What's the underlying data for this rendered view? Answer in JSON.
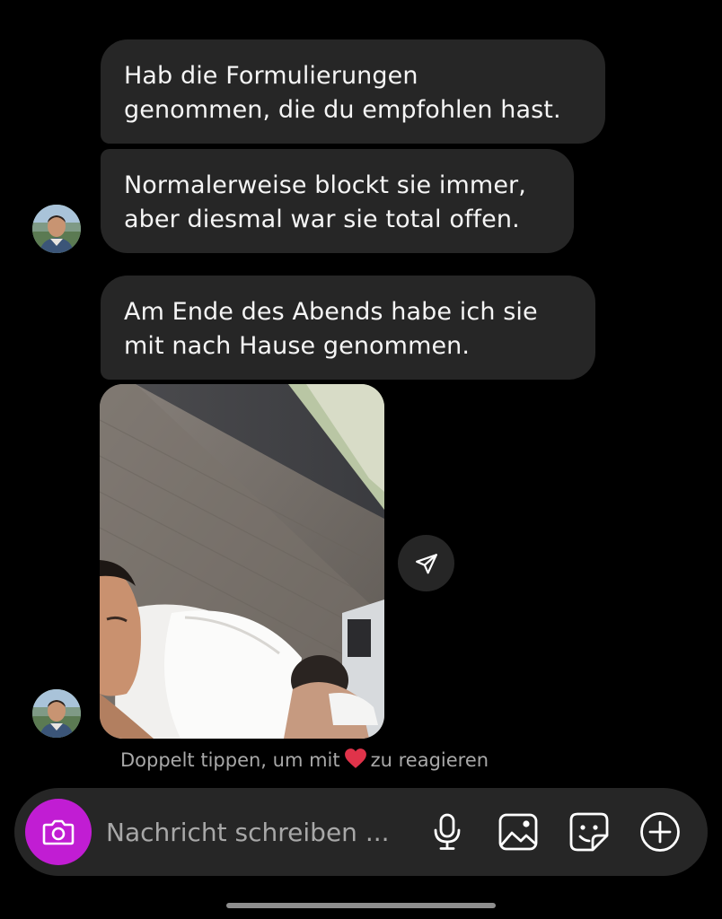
{
  "messages": [
    {
      "lines": [
        "Hab die Formulierungen",
        "genommen, die du empfohlen hast."
      ]
    },
    {
      "lines": [
        "Normalerweise blockt sie immer,",
        "aber diesmal war sie total offen."
      ]
    },
    {
      "lines": [
        "Am Ende des Abends habe ich sie",
        "mit nach Hause genommen."
      ]
    }
  ],
  "reaction_hint": {
    "before": "Doppelt tippen, um mit",
    "after": "zu reagieren",
    "emoji_icon": "heart-icon"
  },
  "composer": {
    "placeholder": "Nachricht schreiben ...",
    "icons": [
      "camera-icon",
      "microphone-icon",
      "gallery-icon",
      "sticker-icon",
      "plus-circle-icon"
    ]
  },
  "colors": {
    "background": "#000000",
    "bubble": "#262626",
    "camera_button": "#c11dd3",
    "hint_text": "#a8a8a8",
    "heart": "#e0334a"
  }
}
